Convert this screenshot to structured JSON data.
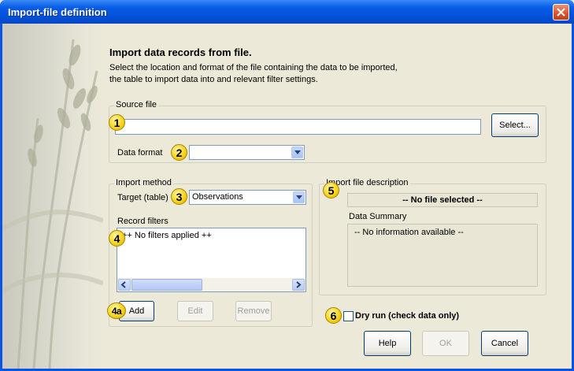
{
  "window": {
    "title": "Import-file definition"
  },
  "heading": "Import data records from file.",
  "description_lines": [
    "Select the location and format of the file containing the data to be imported,",
    "the table to import data into and relevant filter settings."
  ],
  "source_file": {
    "legend": "Source file",
    "path_value": "",
    "select_label": "Select...",
    "data_format_label": "Data format",
    "data_format_value": ""
  },
  "import_method": {
    "legend": "Import method",
    "target_label": "Target (table)",
    "target_value": "Observations",
    "record_filters_label": "Record filters",
    "filters": [
      "++ No filters applied ++"
    ],
    "add_label": "Add",
    "edit_label": "Edit",
    "remove_label": "Remove"
  },
  "file_description": {
    "legend": "Import file description",
    "status": "-- No file selected --",
    "summary_label": "Data Summary",
    "summary_text": "-- No information available --"
  },
  "dry_run": {
    "label": "Dry run (check data only)",
    "checked": false
  },
  "buttons": {
    "help": "Help",
    "ok": "OK",
    "cancel": "Cancel"
  },
  "markers": [
    "1",
    "2",
    "3",
    "4",
    "4a",
    "5",
    "6"
  ],
  "icons": [
    "close-icon",
    "dropdown-arrow-icon",
    "scroll-left-icon",
    "scroll-right-icon"
  ],
  "colors": {
    "titlebar": "#0a54e3",
    "dialog_bg": "#ece9d8",
    "marker": "#f6d41c",
    "close": "#d9532a"
  }
}
